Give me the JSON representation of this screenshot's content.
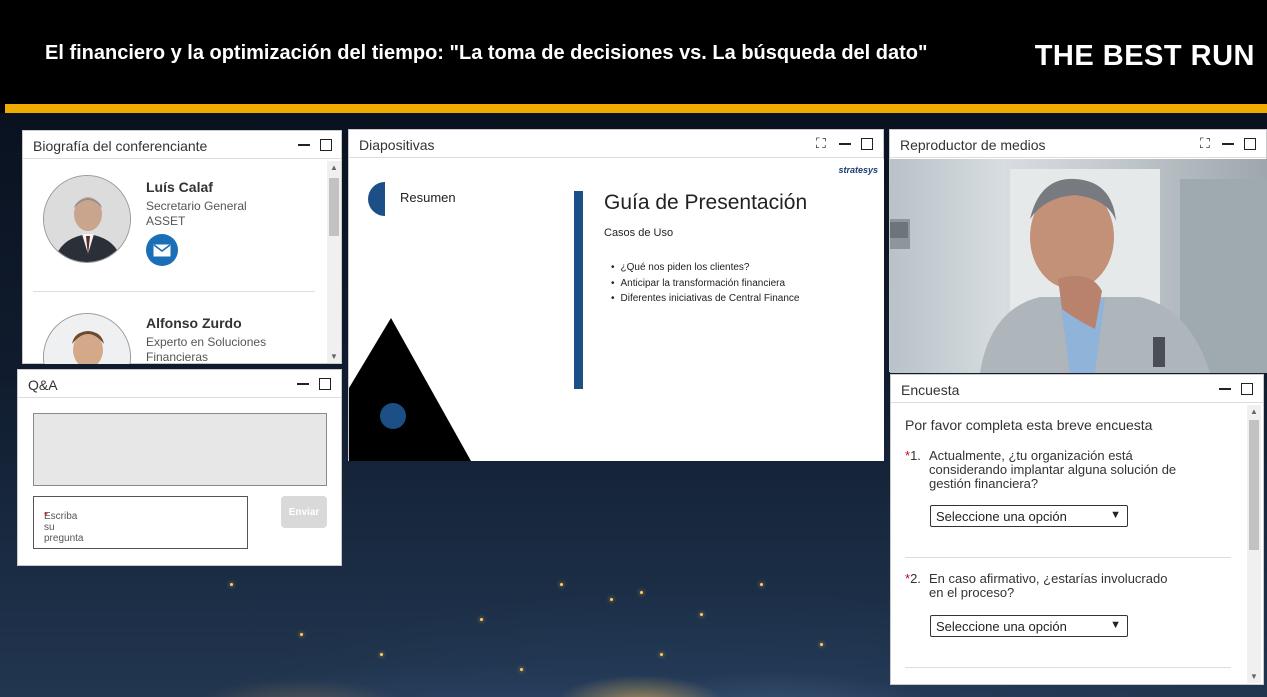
{
  "header": {
    "title": "El financiero y la optimización del tiempo: \"La toma de decisiones vs. La búsqueda del dato\"",
    "brand": "THE BEST RUN"
  },
  "bio_panel": {
    "title": "Biografía del conferenciante",
    "speakers": [
      {
        "name": "Luís Calaf",
        "role_line1": "Secretario General",
        "role_line2": "ASSET"
      },
      {
        "name": "Alfonso Zurdo",
        "role_line1": "Experto en Soluciones",
        "role_line2": "Financieras"
      }
    ]
  },
  "qa_panel": {
    "title": "Q&A",
    "placeholder": "Escriba su pregunta",
    "required_mark": "*",
    "send_label": "Enviar"
  },
  "slides_panel": {
    "title": "Diapositivas",
    "slide": {
      "logo": "stratesys",
      "summary_label": "Resumen",
      "heading": "Guía de Presentación",
      "subheading": "Casos de Uso",
      "bullets": [
        "¿Qué nos piden los clientes?",
        "Anticipar la transformación financiera",
        "Diferentes iniciativas de Central Finance"
      ]
    }
  },
  "media_panel": {
    "title": "Reproductor de medios"
  },
  "survey_panel": {
    "title": "Encuesta",
    "intro": "Por favor completa esta breve encuesta",
    "questions": [
      {
        "number": "1.",
        "required": "*",
        "text": "Actualmente, ¿tu organización está considerando implantar alguna solución de gestión financiera?",
        "select": "Seleccione una opción"
      },
      {
        "number": "2.",
        "required": "*",
        "text": "En caso afirmativo, ¿estarías involucrado en el proceso?",
        "select": "Seleccione una opción"
      }
    ]
  },
  "colors": {
    "accent_bar": "#f0ab00",
    "header_bg": "#000000",
    "mail_button": "#1a6fb6",
    "slide_accent": "#1c4f86",
    "required": "#d0021b"
  },
  "icons": {
    "mail": "mail-icon",
    "minimize": "minimize-icon",
    "maximize": "maximize-icon",
    "fullscreen": "fullscreen-icon",
    "select_arrow": "chevron-down-icon"
  }
}
